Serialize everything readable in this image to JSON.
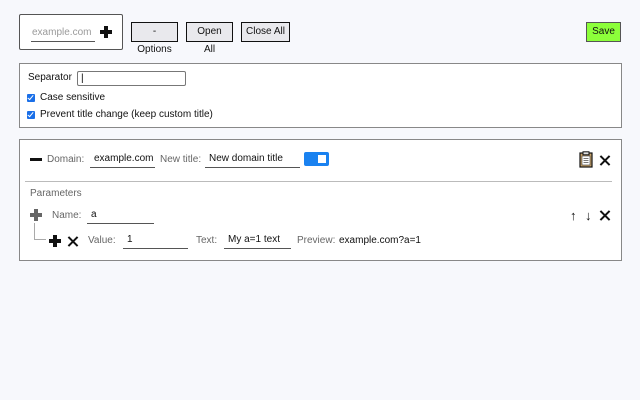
{
  "top": {
    "domain_placeholder": "example.com",
    "options_label": "-Options",
    "open_all_label": "Open All",
    "close_all_label": "Close All",
    "save_label": "Save"
  },
  "settings": {
    "separator_label": "Separator",
    "separator_value": "|",
    "case_sensitive_label": "Case sensitive",
    "case_sensitive_checked": true,
    "prevent_title_label": "Prevent title change (keep custom title)",
    "prevent_title_checked": true
  },
  "domain": {
    "domain_label": "Domain:",
    "domain_value": "example.com",
    "new_title_label": "New title:",
    "new_title_value": "New domain title",
    "enabled": true,
    "parameters_label": "Parameters",
    "param": {
      "name_label": "Name:",
      "name_value": "a",
      "up_arrow": "↑",
      "down_arrow": "↓",
      "value_label": "Value:",
      "value_value": "1",
      "text_label": "Text:",
      "text_value": "My a=1 text",
      "preview_label": "Preview:",
      "preview_value": "example.com?a=1"
    }
  },
  "colors": {
    "save_bg": "#8cff3a",
    "accent": "#1a82f0",
    "page_bg": "#f7f8fc"
  }
}
